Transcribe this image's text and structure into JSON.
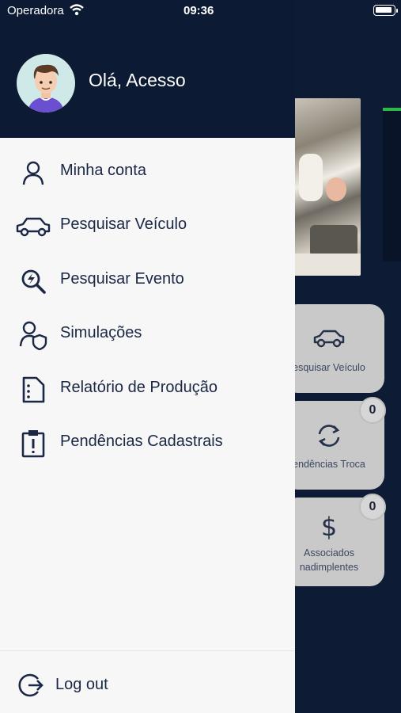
{
  "status_bar": {
    "carrier": "Operadora",
    "time": "09:36"
  },
  "drawer": {
    "greeting": "Olá, Acesso",
    "menu": [
      {
        "label": "Minha conta",
        "icon": "user-icon"
      },
      {
        "label": "Pesquisar Veículo",
        "icon": "car-icon"
      },
      {
        "label": "Pesquisar Evento",
        "icon": "search-event-icon"
      },
      {
        "label": "Simulações",
        "icon": "user-shield-icon"
      },
      {
        "label": "Relatório de Produção",
        "icon": "document-icon"
      },
      {
        "label": "Pendências Cadastrais",
        "icon": "clipboard-alert-icon"
      }
    ],
    "logout_label": "Log out"
  },
  "background": {
    "cards": [
      {
        "label": "esquisar Veículo",
        "icon": "car-icon"
      },
      {
        "label": "endências Troca",
        "icon": "refresh-icon",
        "badge": "0"
      },
      {
        "label_line1": "Associados",
        "label_line2": "nadimplentes",
        "icon": "dollar-icon",
        "badge": "0"
      }
    ]
  },
  "colors": {
    "header_bg": "#0d1a33",
    "drawer_bg": "#f7f7f8",
    "text_primary": "#1a2745"
  }
}
